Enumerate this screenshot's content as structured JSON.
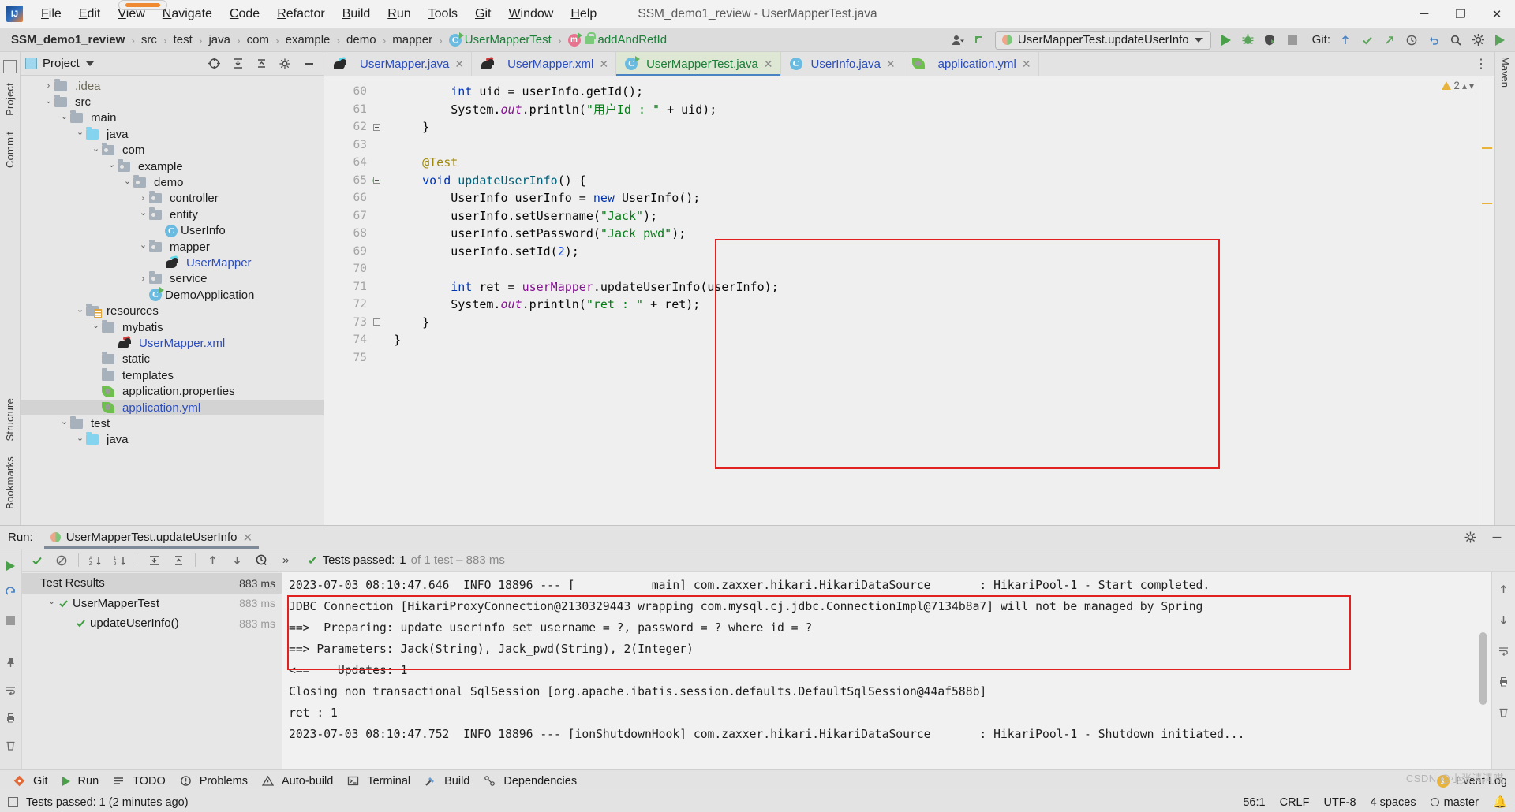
{
  "window": {
    "title": "SSM_demo1_review - UserMapperTest.java",
    "logo_text": "IJ",
    "minimize": "─",
    "maximize": "❐",
    "close": "✕"
  },
  "menu": [
    {
      "label": "File",
      "accel": "F"
    },
    {
      "label": "Edit",
      "accel": "E"
    },
    {
      "label": "View",
      "accel": "V"
    },
    {
      "label": "Navigate",
      "accel": "N"
    },
    {
      "label": "Code",
      "accel": "C"
    },
    {
      "label": "Refactor",
      "accel": "R"
    },
    {
      "label": "Build",
      "accel": "B"
    },
    {
      "label": "Run",
      "accel": "R"
    },
    {
      "label": "Tools",
      "accel": "T"
    },
    {
      "label": "Git",
      "accel": "G"
    },
    {
      "label": "Window",
      "accel": "W"
    },
    {
      "label": "Help",
      "accel": "H"
    }
  ],
  "breadcrumb": {
    "separator": "›",
    "items": [
      {
        "label": "SSM_demo1_review",
        "type": "project"
      },
      {
        "label": "src",
        "type": "dir"
      },
      {
        "label": "test",
        "type": "dir"
      },
      {
        "label": "java",
        "type": "dir"
      },
      {
        "label": "com",
        "type": "dir"
      },
      {
        "label": "example",
        "type": "dir"
      },
      {
        "label": "demo",
        "type": "dir"
      },
      {
        "label": "mapper",
        "type": "dir"
      },
      {
        "label": "UserMapperTest",
        "type": "class"
      },
      {
        "label": "addAndRetId",
        "type": "method"
      }
    ]
  },
  "toolbar": {
    "run_config": "UserMapperTest.updateUserInfo",
    "git_label": "Git:",
    "run_tooltip": "Run",
    "debug_tooltip": "Debug",
    "coverage_tooltip": "Run with Coverage",
    "stop_tooltip": "Stop"
  },
  "left_strip": {
    "project": "Project",
    "commit": "Commit",
    "structure": "Structure",
    "bookmarks": "Bookmarks"
  },
  "right_strip": {
    "maven": "Maven"
  },
  "project_pane": {
    "title": "Project",
    "tree": [
      {
        "label": ".idea",
        "depth": 1,
        "arrow": "›",
        "icon": "folder",
        "style": "dim"
      },
      {
        "label": "src",
        "depth": 1,
        "arrow": "⌄",
        "icon": "folder",
        "style": "normal"
      },
      {
        "label": "main",
        "depth": 2,
        "arrow": "⌄",
        "icon": "folder",
        "style": "normal"
      },
      {
        "label": "java",
        "depth": 3,
        "arrow": "⌄",
        "icon": "folder-blue",
        "style": "normal"
      },
      {
        "label": "com",
        "depth": 4,
        "arrow": "⌄",
        "icon": "package",
        "style": "normal"
      },
      {
        "label": "example",
        "depth": 5,
        "arrow": "⌄",
        "icon": "package",
        "style": "normal"
      },
      {
        "label": "demo",
        "depth": 6,
        "arrow": "⌄",
        "icon": "package",
        "style": "normal"
      },
      {
        "label": "controller",
        "depth": 7,
        "arrow": "›",
        "icon": "package",
        "style": "normal"
      },
      {
        "label": "entity",
        "depth": 7,
        "arrow": "⌄",
        "icon": "package",
        "style": "normal"
      },
      {
        "label": "UserInfo",
        "depth": 8,
        "arrow": "",
        "icon": "class",
        "style": "normal"
      },
      {
        "label": "mapper",
        "depth": 7,
        "arrow": "⌄",
        "icon": "package",
        "style": "normal"
      },
      {
        "label": "UserMapper",
        "depth": 8,
        "arrow": "",
        "icon": "mybatis",
        "style": "blue"
      },
      {
        "label": "service",
        "depth": 7,
        "arrow": "›",
        "icon": "package",
        "style": "normal"
      },
      {
        "label": "DemoApplication",
        "depth": 7,
        "arrow": "",
        "icon": "class-run",
        "style": "normal"
      },
      {
        "label": "resources",
        "depth": 3,
        "arrow": "⌄",
        "icon": "folder-res",
        "style": "normal"
      },
      {
        "label": "mybatis",
        "depth": 4,
        "arrow": "⌄",
        "icon": "folder",
        "style": "normal"
      },
      {
        "label": "UserMapper.xml",
        "depth": 5,
        "arrow": "",
        "icon": "mybatis-red",
        "style": "blue"
      },
      {
        "label": "static",
        "depth": 4,
        "arrow": "",
        "icon": "folder",
        "style": "normal"
      },
      {
        "label": "templates",
        "depth": 4,
        "arrow": "",
        "icon": "folder",
        "style": "normal"
      },
      {
        "label": "application.properties",
        "depth": 4,
        "arrow": "",
        "icon": "yaml",
        "style": "normal"
      },
      {
        "label": "application.yml",
        "depth": 4,
        "arrow": "",
        "icon": "yaml",
        "style": "blue",
        "selected": true
      },
      {
        "label": "test",
        "depth": 2,
        "arrow": "⌄",
        "icon": "folder",
        "style": "normal"
      },
      {
        "label": "java",
        "depth": 3,
        "arrow": "⌄",
        "icon": "folder-blue",
        "style": "normal"
      }
    ]
  },
  "editor": {
    "tabs": [
      {
        "label": "UserMapper.java",
        "icon": "mybatis",
        "active": false,
        "close": "✕"
      },
      {
        "label": "UserMapper.xml",
        "icon": "mybatis-red",
        "active": false,
        "close": "✕"
      },
      {
        "label": "UserMapperTest.java",
        "icon": "class-run",
        "active": true,
        "close": "✕"
      },
      {
        "label": "UserInfo.java",
        "icon": "class",
        "active": false,
        "close": "✕"
      },
      {
        "label": "application.yml",
        "icon": "yaml",
        "active": false,
        "close": "✕"
      }
    ],
    "warning_count": "2",
    "lines": [
      {
        "no": "60",
        "tokens": [
          {
            "t": "        ",
            "c": "pl"
          },
          {
            "t": "int",
            "c": "k"
          },
          {
            "t": " uid = userInfo.getId();",
            "c": "pl"
          }
        ]
      },
      {
        "no": "61",
        "tokens": [
          {
            "t": "        System.",
            "c": "pl"
          },
          {
            "t": "out",
            "c": "fld"
          },
          {
            "t": ".println(",
            "c": "pl"
          },
          {
            "t": "\"用户Id : \"",
            "c": "str"
          },
          {
            "t": " + uid);",
            "c": "pl"
          }
        ]
      },
      {
        "no": "62",
        "tokens": [
          {
            "t": "    }",
            "c": "pl"
          }
        ],
        "fold": true
      },
      {
        "no": "63",
        "tokens": [
          {
            "t": "",
            "c": "pl"
          }
        ]
      },
      {
        "no": "64",
        "tokens": [
          {
            "t": "    ",
            "c": "pl"
          },
          {
            "t": "@Test",
            "c": "ann"
          }
        ]
      },
      {
        "no": "65",
        "tokens": [
          {
            "t": "    ",
            "c": "pl"
          },
          {
            "t": "void",
            "c": "k"
          },
          {
            "t": " ",
            "c": "pl"
          },
          {
            "t": "updateUserInfo",
            "c": "meth"
          },
          {
            "t": "() {",
            "c": "pl"
          }
        ],
        "runmark": true,
        "fold": true
      },
      {
        "no": "66",
        "tokens": [
          {
            "t": "        UserInfo userInfo = ",
            "c": "pl"
          },
          {
            "t": "new",
            "c": "k"
          },
          {
            "t": " UserInfo();",
            "c": "pl"
          }
        ]
      },
      {
        "no": "67",
        "tokens": [
          {
            "t": "        userInfo.setUsername(",
            "c": "pl"
          },
          {
            "t": "\"Jack\"",
            "c": "str"
          },
          {
            "t": ");",
            "c": "pl"
          }
        ]
      },
      {
        "no": "68",
        "tokens": [
          {
            "t": "        userInfo.setPassword(",
            "c": "pl"
          },
          {
            "t": "\"Jack_pwd\"",
            "c": "str"
          },
          {
            "t": ");",
            "c": "pl"
          }
        ]
      },
      {
        "no": "69",
        "tokens": [
          {
            "t": "        userInfo.setId(",
            "c": "pl"
          },
          {
            "t": "2",
            "c": "num"
          },
          {
            "t": ");",
            "c": "pl"
          }
        ]
      },
      {
        "no": "70",
        "tokens": [
          {
            "t": "",
            "c": "pl"
          }
        ]
      },
      {
        "no": "71",
        "tokens": [
          {
            "t": "        ",
            "c": "pl"
          },
          {
            "t": "int",
            "c": "k"
          },
          {
            "t": " ret = ",
            "c": "pl"
          },
          {
            "t": "userMapper",
            "c": "var"
          },
          {
            "t": ".updateUserInfo(userInfo);",
            "c": "pl"
          }
        ]
      },
      {
        "no": "72",
        "tokens": [
          {
            "t": "        System.",
            "c": "pl"
          },
          {
            "t": "out",
            "c": "fld"
          },
          {
            "t": ".println(",
            "c": "pl"
          },
          {
            "t": "\"ret : \"",
            "c": "str"
          },
          {
            "t": " + ret);",
            "c": "pl"
          }
        ]
      },
      {
        "no": "73",
        "tokens": [
          {
            "t": "    }",
            "c": "pl"
          }
        ],
        "fold": true
      },
      {
        "no": "74",
        "tokens": [
          {
            "t": "}",
            "c": "pl"
          }
        ]
      },
      {
        "no": "75",
        "tokens": [
          {
            "t": "",
            "c": "pl"
          }
        ]
      }
    ]
  },
  "run_window": {
    "label": "Run:",
    "tab_label": "UserMapperTest.updateUserInfo",
    "tab_close": "✕",
    "settings_icon": "gear-icon",
    "hide_icon": "─",
    "status_prefix": "Tests passed:",
    "status_count": "1",
    "status_suffix": "of 1 test – 883 ms",
    "tests": [
      {
        "label": "Test Results",
        "depth": 0,
        "arrow": "",
        "icon": "none",
        "ms": "883 ms",
        "selected": true,
        "dim": false
      },
      {
        "label": "UserMapperTest",
        "depth": 1,
        "arrow": "⌄",
        "icon": "check",
        "ms": "883 ms",
        "selected": false,
        "dim": true
      },
      {
        "label": "updateUserInfo()",
        "depth": 2,
        "arrow": "",
        "icon": "check",
        "ms": "883 ms",
        "selected": false,
        "dim": true
      }
    ],
    "console": [
      "2023-07-03 08:10:47.646  INFO 18896 --- [           main] com.zaxxer.hikari.HikariDataSource       : HikariPool-1 - Start completed.",
      "JDBC Connection [HikariProxyConnection@2130329443 wrapping com.mysql.cj.jdbc.ConnectionImpl@7134b8a7] will not be managed by Spring",
      "==>  Preparing: update userinfo set username = ?, password = ? where id = ?",
      "==> Parameters: Jack(String), Jack_pwd(String), 2(Integer)",
      "<==    Updates: 1",
      "Closing non transactional SqlSession [org.apache.ibatis.session.defaults.DefaultSqlSession@44af588b]",
      "ret : 1",
      "2023-07-03 08:10:47.752  INFO 18896 --- [ionShutdownHook] com.zaxxer.hikari.HikariDataSource       : HikariPool-1 - Shutdown initiated..."
    ]
  },
  "bottom_bar": {
    "items": [
      {
        "label": "Git",
        "icon": "git-icon"
      },
      {
        "label": "Run",
        "icon": "play-icon"
      },
      {
        "label": "TODO",
        "icon": "todo-icon"
      },
      {
        "label": "Problems",
        "icon": "problems-icon"
      },
      {
        "label": "Auto-build",
        "icon": "warning-icon"
      },
      {
        "label": "Terminal",
        "icon": "terminal-icon"
      },
      {
        "label": "Build",
        "icon": "hammer-icon"
      },
      {
        "label": "Dependencies",
        "icon": "dependencies-icon"
      }
    ],
    "event_log": "Event Log",
    "event_log_count": "1"
  },
  "status_bar": {
    "message": "Tests passed: 1 (2 minutes ago)",
    "caret": "56:1",
    "line_sep": "CRLF",
    "encoding": "UTF-8",
    "indent": "4 spaces",
    "branch": "master"
  },
  "watermark": "CSDN @小张清清喵",
  "colors": {
    "accent_blue": "#4a83c4",
    "active_tab_bg": "#dde7d3",
    "highlight_red": "#e12020",
    "pass_green": "#3f9e3f",
    "keyword": "#0033b3",
    "string": "#067d17",
    "number": "#1750eb",
    "annotation": "#9e880d",
    "field": "#871094",
    "method": "#00627a",
    "link_blue": "#2b4dbd",
    "panel_bg": "#e7e7e7"
  }
}
